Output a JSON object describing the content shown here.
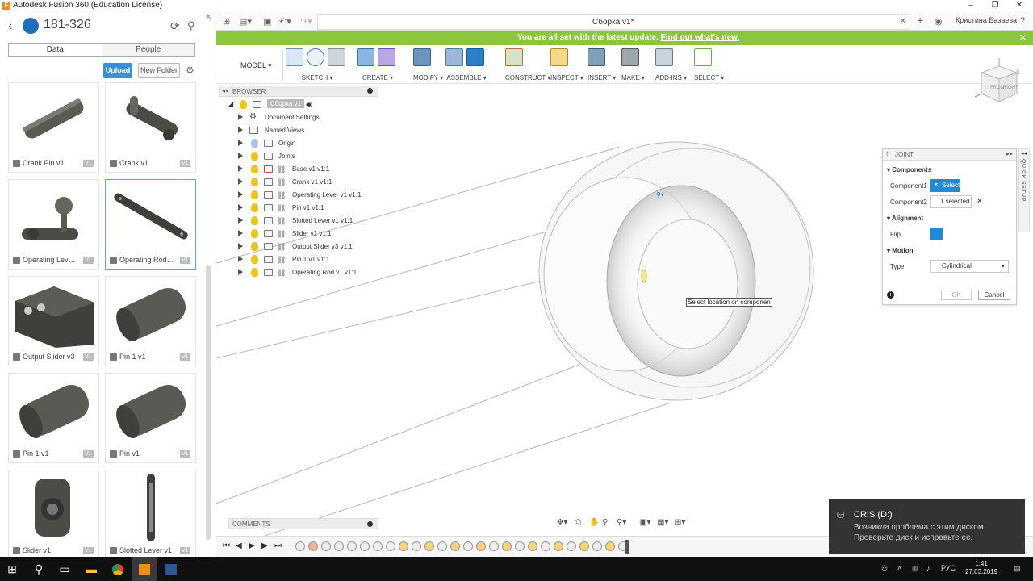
{
  "window": {
    "title": "Autodesk Fusion 360 (Education License)",
    "logo_letter": "F",
    "controls": [
      "–",
      "❐",
      "✕"
    ]
  },
  "left_panel": {
    "project_name": "181-326",
    "tabs": [
      "Data",
      "People"
    ],
    "upload_label": "Upload",
    "new_folder_label": "New Folder",
    "items": [
      {
        "name": "Crank Pin v1",
        "version": "V1"
      },
      {
        "name": "Crank v1",
        "version": "V1"
      },
      {
        "name": "Operating Lever ...",
        "version": "V1"
      },
      {
        "name": "Operating Rod v1",
        "version": "V1"
      },
      {
        "name": "Output Slider v3",
        "version": "V1"
      },
      {
        "name": "Pin 1 v1",
        "version": "V1"
      },
      {
        "name": "Pin 1 v1",
        "version": "V1"
      },
      {
        "name": "Pin v1",
        "version": "V1"
      },
      {
        "name": "Slider v1",
        "version": "V1"
      },
      {
        "name": "Slotted Lever v1",
        "version": "V1"
      }
    ]
  },
  "tabbar": {
    "document_title": "Сборка v1*",
    "user_name": "Кристина Базаева"
  },
  "banner": {
    "message": "You are all set with the latest update.",
    "link": "Find out what's new."
  },
  "ribbon": {
    "mode": "MODEL ▾",
    "groups": [
      "SKETCH ▾",
      "CREATE ▾",
      "MODIFY ▾",
      "ASSEMBLE ▾",
      "CONSTRUCT ▾",
      "INSPECT ▾",
      "INSERT ▾",
      "MAKE ▾",
      "ADD-INS ▾",
      "SELECT ▾"
    ]
  },
  "browser": {
    "title": "BROWSER",
    "root": "Сборка v1",
    "rows": [
      "Document Settings",
      "Named Views",
      "Origin",
      "Joints",
      "Base v1 v1:1",
      "Crank v1 v1:1",
      "Operating Lever v1 v1:1",
      "Pin v1 v1:1",
      "Slotted Lever v1 v1:1",
      "Slider v1 v1:1",
      "Output Slider v3 v1:1",
      "Pin 1 v1 v1:1",
      "Operating Rod v1 v1:1"
    ]
  },
  "joint_panel": {
    "title": "JOINT",
    "components_section": "Components",
    "component1_label": "Component1",
    "component1_value": "Select",
    "component2_label": "Component2",
    "component2_value": "1 selected",
    "alignment_section": "Alignment",
    "flip_label": "Flip",
    "motion_section": "Motion",
    "type_label": "Type",
    "type_value": "Cylindrical",
    "ok_label": "OK",
    "cancel_label": "Cancel"
  },
  "quick_setup": "QUICK SETUP",
  "viewport_tooltip": "Select location on componen",
  "viewcube": {
    "front": "FRONT",
    "right": "RIGHT"
  },
  "comments_label": "COMMENTS",
  "notification": {
    "title": "CRIS (D:)",
    "body_line1": "Возникла проблема с этим диском.",
    "body_line2": "Проверьте диск и исправьте ее."
  },
  "taskbar": {
    "language": "РУС",
    "time": "1:41",
    "date": "27.03.2019"
  },
  "colors": {
    "banner_green": "#8cc63f",
    "accent_blue": "#1f8ad6",
    "taskbar": "#101010"
  }
}
